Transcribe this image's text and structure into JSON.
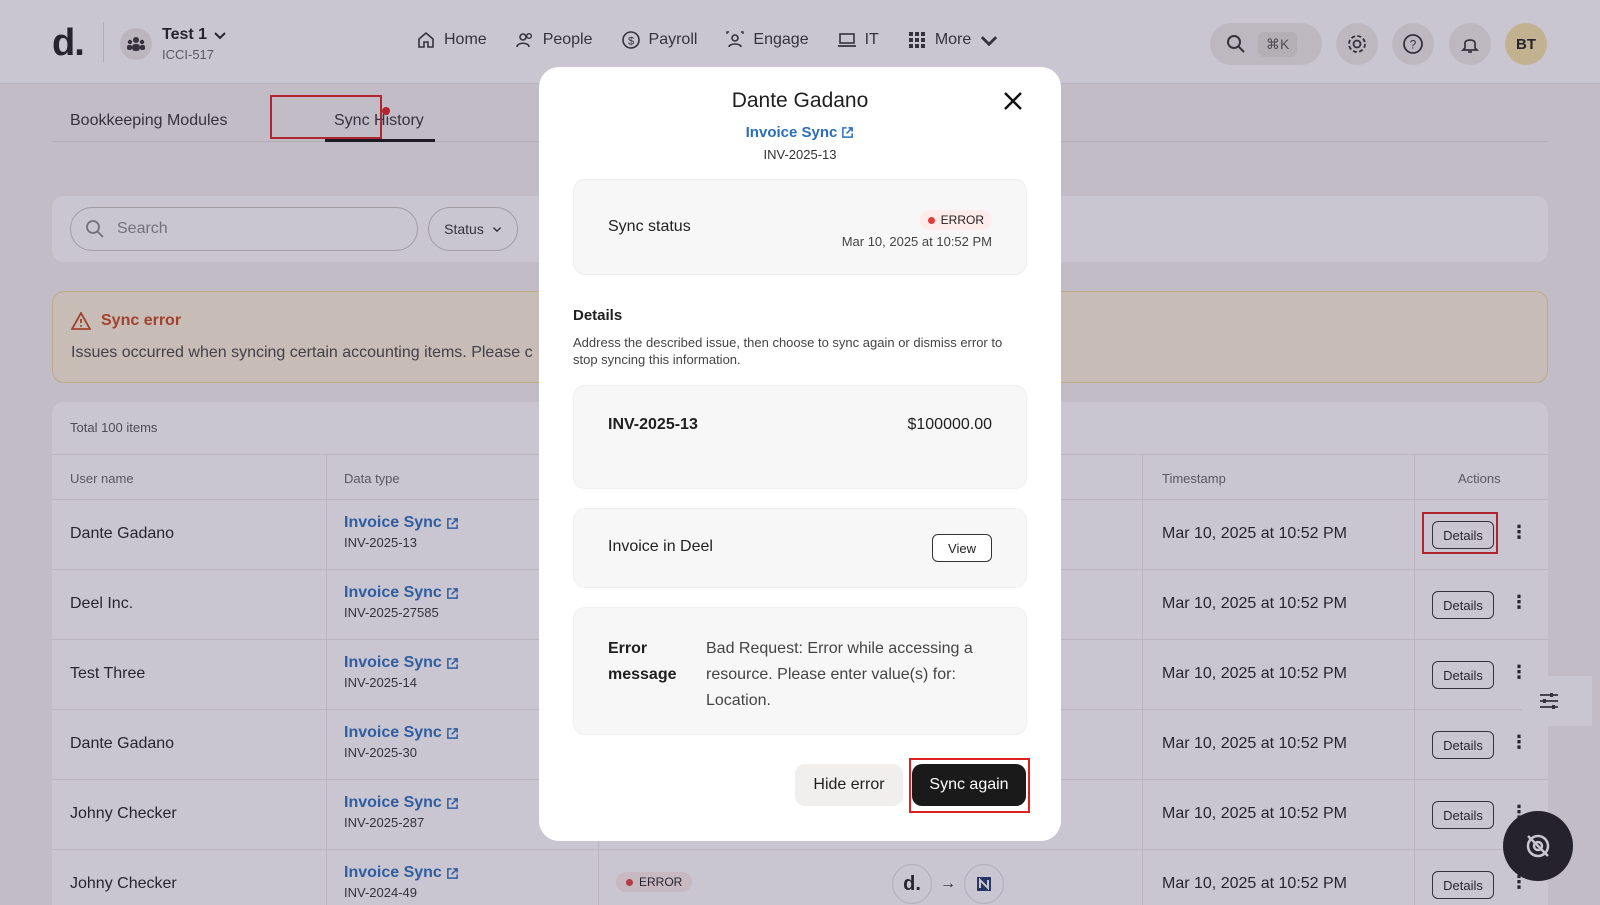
{
  "brand": {
    "logo": "d."
  },
  "org": {
    "name": "Test 1",
    "id": "ICCI-517"
  },
  "nav": [
    {
      "label": "Home",
      "icon": "home-icon"
    },
    {
      "label": "People",
      "icon": "people-icon"
    },
    {
      "label": "Payroll",
      "icon": "payroll-icon"
    },
    {
      "label": "Engage",
      "icon": "engage-icon"
    },
    {
      "label": "IT",
      "icon": "laptop-icon"
    },
    {
      "label": "More",
      "icon": "grid-icon"
    }
  ],
  "header": {
    "shortcut": "⌘K",
    "avatar": "BT"
  },
  "tabs": {
    "modules": "Bookkeeping Modules",
    "history": "Sync History"
  },
  "filters": {
    "search_placeholder": "Search",
    "status": "Status"
  },
  "alert": {
    "title": "Sync error",
    "text": "Issues occurred when syncing certain accounting items. Please c"
  },
  "table": {
    "total": "Total 100 items",
    "headers": {
      "user": "User name",
      "type": "Data type",
      "timestamp": "Timestamp",
      "actions": "Actions"
    },
    "details_label": "Details",
    "rows": [
      {
        "user": "Dante Gadano",
        "type": "Invoice Sync",
        "ref": "INV-2025-13",
        "timestamp": "Mar 10, 2025 at 10:52 PM"
      },
      {
        "user": "Deel Inc.",
        "type": "Invoice Sync",
        "ref": "INV-2025-27585",
        "timestamp": "Mar 10, 2025 at 10:52 PM"
      },
      {
        "user": "Test Three",
        "type": "Invoice Sync",
        "ref": "INV-2025-14",
        "timestamp": "Mar 10, 2025 at 10:52 PM"
      },
      {
        "user": "Dante Gadano",
        "type": "Invoice Sync",
        "ref": "INV-2025-30",
        "timestamp": "Mar 10, 2025 at 10:52 PM"
      },
      {
        "user": "Johny Checker",
        "type": "Invoice Sync",
        "ref": "INV-2025-287",
        "timestamp": "Mar 10, 2025 at 10:52 PM"
      },
      {
        "user": "Johny Checker",
        "type": "Invoice Sync",
        "ref": "INV-2024-49",
        "timestamp": "Mar 10, 2025 at 10:52 PM",
        "status": "ERROR"
      }
    ]
  },
  "modal": {
    "title": "Dante Gadano",
    "link": "Invoice Sync",
    "ref": "INV-2025-13",
    "sync_status_label": "Sync status",
    "status": "ERROR",
    "status_time": "Mar 10, 2025 at 10:52 PM",
    "details_heading": "Details",
    "details_text": "Address the described issue, then choose to sync again or dismiss error to stop syncing this information.",
    "invoice_id": "INV-2025-13",
    "invoice_amount": "$100000.00",
    "deel_label": "Invoice in Deel",
    "view_label": "View",
    "error_label": "Error message",
    "error_text": "Bad Request: Error while accessing a resource. Please enter value(s) for: Location.",
    "hide_label": "Hide error",
    "sync_label": "Sync again"
  },
  "colors": {
    "accent_link": "#2a6ebb",
    "error": "#e0403a",
    "highlight": "#e0201e"
  }
}
